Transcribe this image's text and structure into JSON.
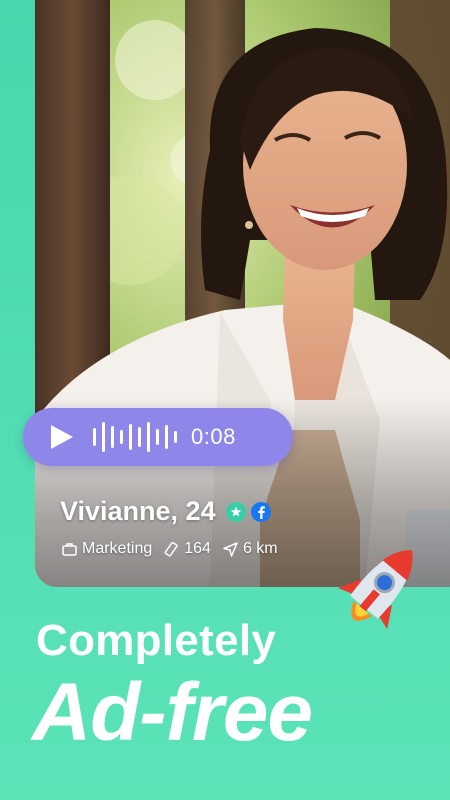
{
  "profile": {
    "name_age": "Vivianne, 24",
    "job": "Marketing",
    "count": "164",
    "distance": "6 km",
    "photo_icon": "profile-photo"
  },
  "voice": {
    "duration": "0:08",
    "play_icon": "play-icon"
  },
  "badges": {
    "verified_icon": "star-icon",
    "social_icon": "facebook-icon"
  },
  "headline": {
    "line1": "Completely",
    "line2": "Ad-free"
  },
  "colors": {
    "background": "#4fdcb0",
    "voice_pill": "#8f86ea",
    "verified_badge": "#38cfa6",
    "facebook": "#1877f2"
  }
}
